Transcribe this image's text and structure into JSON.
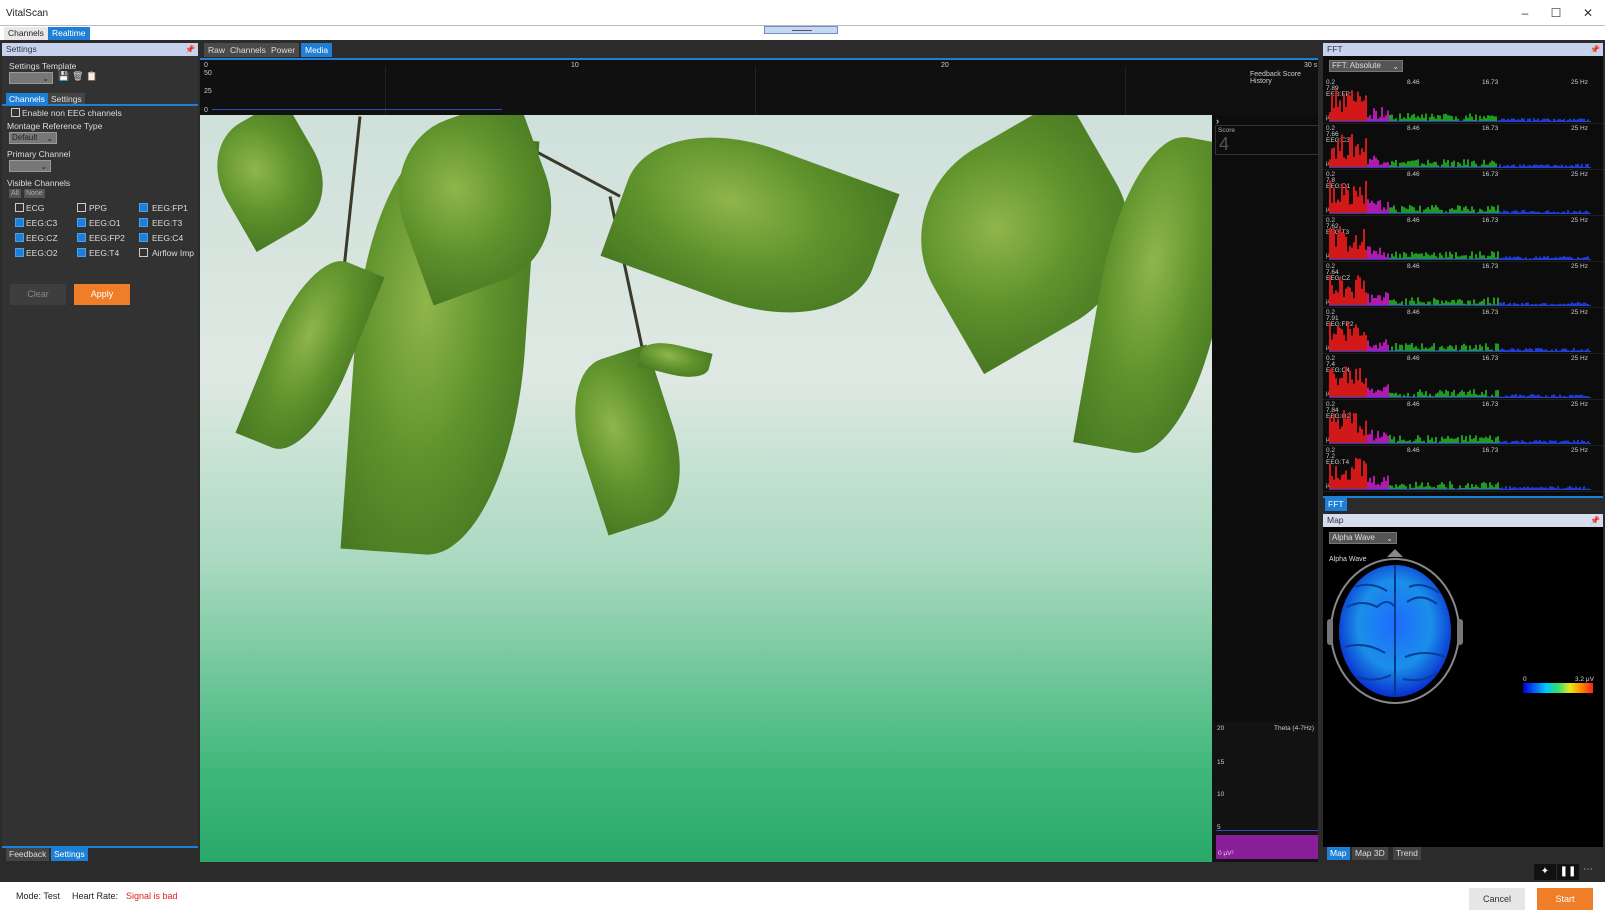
{
  "app": {
    "title": "VitalScan"
  },
  "mode_tabs": [
    {
      "label": "Channels"
    },
    {
      "label": "Realtime"
    }
  ],
  "settings_panel": {
    "header": "Settings",
    "template_label": "Settings Template",
    "subtabs": [
      {
        "label": "Channels"
      },
      {
        "label": "Settings"
      }
    ],
    "enable_non_eeg": "Enable non EEG channels",
    "montage_label": "Montage Reference Type",
    "montage_value": "Default",
    "primary_label": "Primary Channel",
    "visible_label": "Visible Channels",
    "all_label": "All",
    "none_label": "None",
    "channels": [
      {
        "label": "ECG",
        "checked": false
      },
      {
        "label": "PPG",
        "checked": false
      },
      {
        "label": "EEG:FP1",
        "checked": true
      },
      {
        "label": "EEG:C3",
        "checked": true
      },
      {
        "label": "EEG:O1",
        "checked": true
      },
      {
        "label": "EEG:T3",
        "checked": true
      },
      {
        "label": "EEG:CZ",
        "checked": true
      },
      {
        "label": "EEG:FP2",
        "checked": true
      },
      {
        "label": "EEG:C4",
        "checked": true
      },
      {
        "label": "EEG:O2",
        "checked": true
      },
      {
        "label": "EEG:T4",
        "checked": true
      },
      {
        "label": "Airflow Imp",
        "checked": false
      }
    ],
    "clear_label": "Clear",
    "apply_label": "Apply",
    "bottom_tabs": [
      {
        "label": "Feedback"
      },
      {
        "label": "Settings"
      }
    ]
  },
  "center": {
    "tabs": [
      {
        "label": "Raw"
      },
      {
        "label": "Channels"
      },
      {
        "label": "Power"
      },
      {
        "label": "Media"
      }
    ],
    "history": {
      "title": "Feedback Score History",
      "x_ticks": [
        "0",
        "10",
        "20",
        "30 s"
      ],
      "y_ticks": [
        "50",
        "25",
        "0"
      ]
    },
    "score_label": "Score",
    "score_value": "4",
    "theta": {
      "title": "Theta (4-7Hz)",
      "ticks": [
        "20",
        "15",
        "10",
        "5"
      ],
      "unit": "0 µV²"
    }
  },
  "fft": {
    "header": "FFT",
    "mode": "FFT: Absolute",
    "freq_ticks": [
      "8.46",
      "16.73",
      "25 Hz"
    ],
    "rows": [
      {
        "top": "0.2",
        "max": "7.89",
        "channel": "EEG:FP1"
      },
      {
        "top": "0.2",
        "max": "7.66",
        "channel": "EEG:C3"
      },
      {
        "top": "0.2",
        "max": "7.8",
        "channel": "EEG:O1"
      },
      {
        "top": "0.2",
        "max": "7.62",
        "channel": "EEG:T3"
      },
      {
        "top": "0.2",
        "max": "7.64",
        "channel": "EEG:CZ"
      },
      {
        "top": "0.2",
        "max": "7.91",
        "channel": "EEG:FP2"
      },
      {
        "top": "0.2",
        "max": "7.4",
        "channel": "EEG:C4"
      },
      {
        "top": "0.2",
        "max": "7.84",
        "channel": "EEG:O2"
      },
      {
        "top": "0.2",
        "max": "7.2",
        "channel": "EEG:T4"
      }
    ],
    "unit": "µV²",
    "bottom_tab": "FFT"
  },
  "map": {
    "header": "Map",
    "band": "Alpha Wave",
    "title": "Alpha Wave",
    "scale_min": "0",
    "scale_max": "3.2 µV",
    "tabs": [
      {
        "label": "Map"
      },
      {
        "label": "Map 3D"
      },
      {
        "label": "Trend"
      }
    ]
  },
  "status": {
    "mode": "Mode: Test",
    "heart_rate_label": "Heart Rate:",
    "heart_rate_value": "Signal is bad",
    "cancel_label": "Cancel",
    "start_label": "Start"
  },
  "colors": {
    "accent": "#1e7fd6",
    "orange": "#f07d28",
    "error": "#e0201e"
  }
}
